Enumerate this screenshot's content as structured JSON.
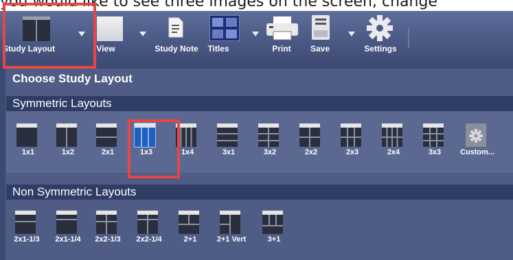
{
  "instruction_text": "you would like to see three images on the screen, change",
  "toolbar": {
    "items": [
      {
        "label": "Study Layout",
        "icon": "layout-icon"
      },
      {
        "label": "View",
        "icon": "view-icon"
      },
      {
        "label": "Study Note",
        "icon": "note-icon"
      },
      {
        "label": "Titles",
        "icon": "titles-icon"
      },
      {
        "label": "Print",
        "icon": "printer-icon"
      },
      {
        "label": "Save",
        "icon": "save-icon"
      },
      {
        "label": "Settings",
        "icon": "gear-icon"
      }
    ]
  },
  "panel": {
    "title": "Choose Study Layout",
    "symmetric": {
      "header": "Symmetric Layouts",
      "items": [
        "1x1",
        "1x2",
        "2x1",
        "1x3",
        "1x4",
        "3x1",
        "3x2",
        "2x2",
        "2x3",
        "2x4",
        "3x3",
        "Custom..."
      ],
      "selected": "1x3"
    },
    "non_symmetric": {
      "header": "Non Symmetric Layouts",
      "items": [
        "2x1-1/3",
        "2x1-1/4",
        "2x2-1/3",
        "2x2-1/4",
        "2+1",
        "2+1 Vert",
        "3+1"
      ]
    }
  },
  "colors": {
    "highlight": "#e64646",
    "selected_fill": "#1f5fbf",
    "icon_dark": "#2b2f3d",
    "icon_light": "#e6e6e6"
  }
}
